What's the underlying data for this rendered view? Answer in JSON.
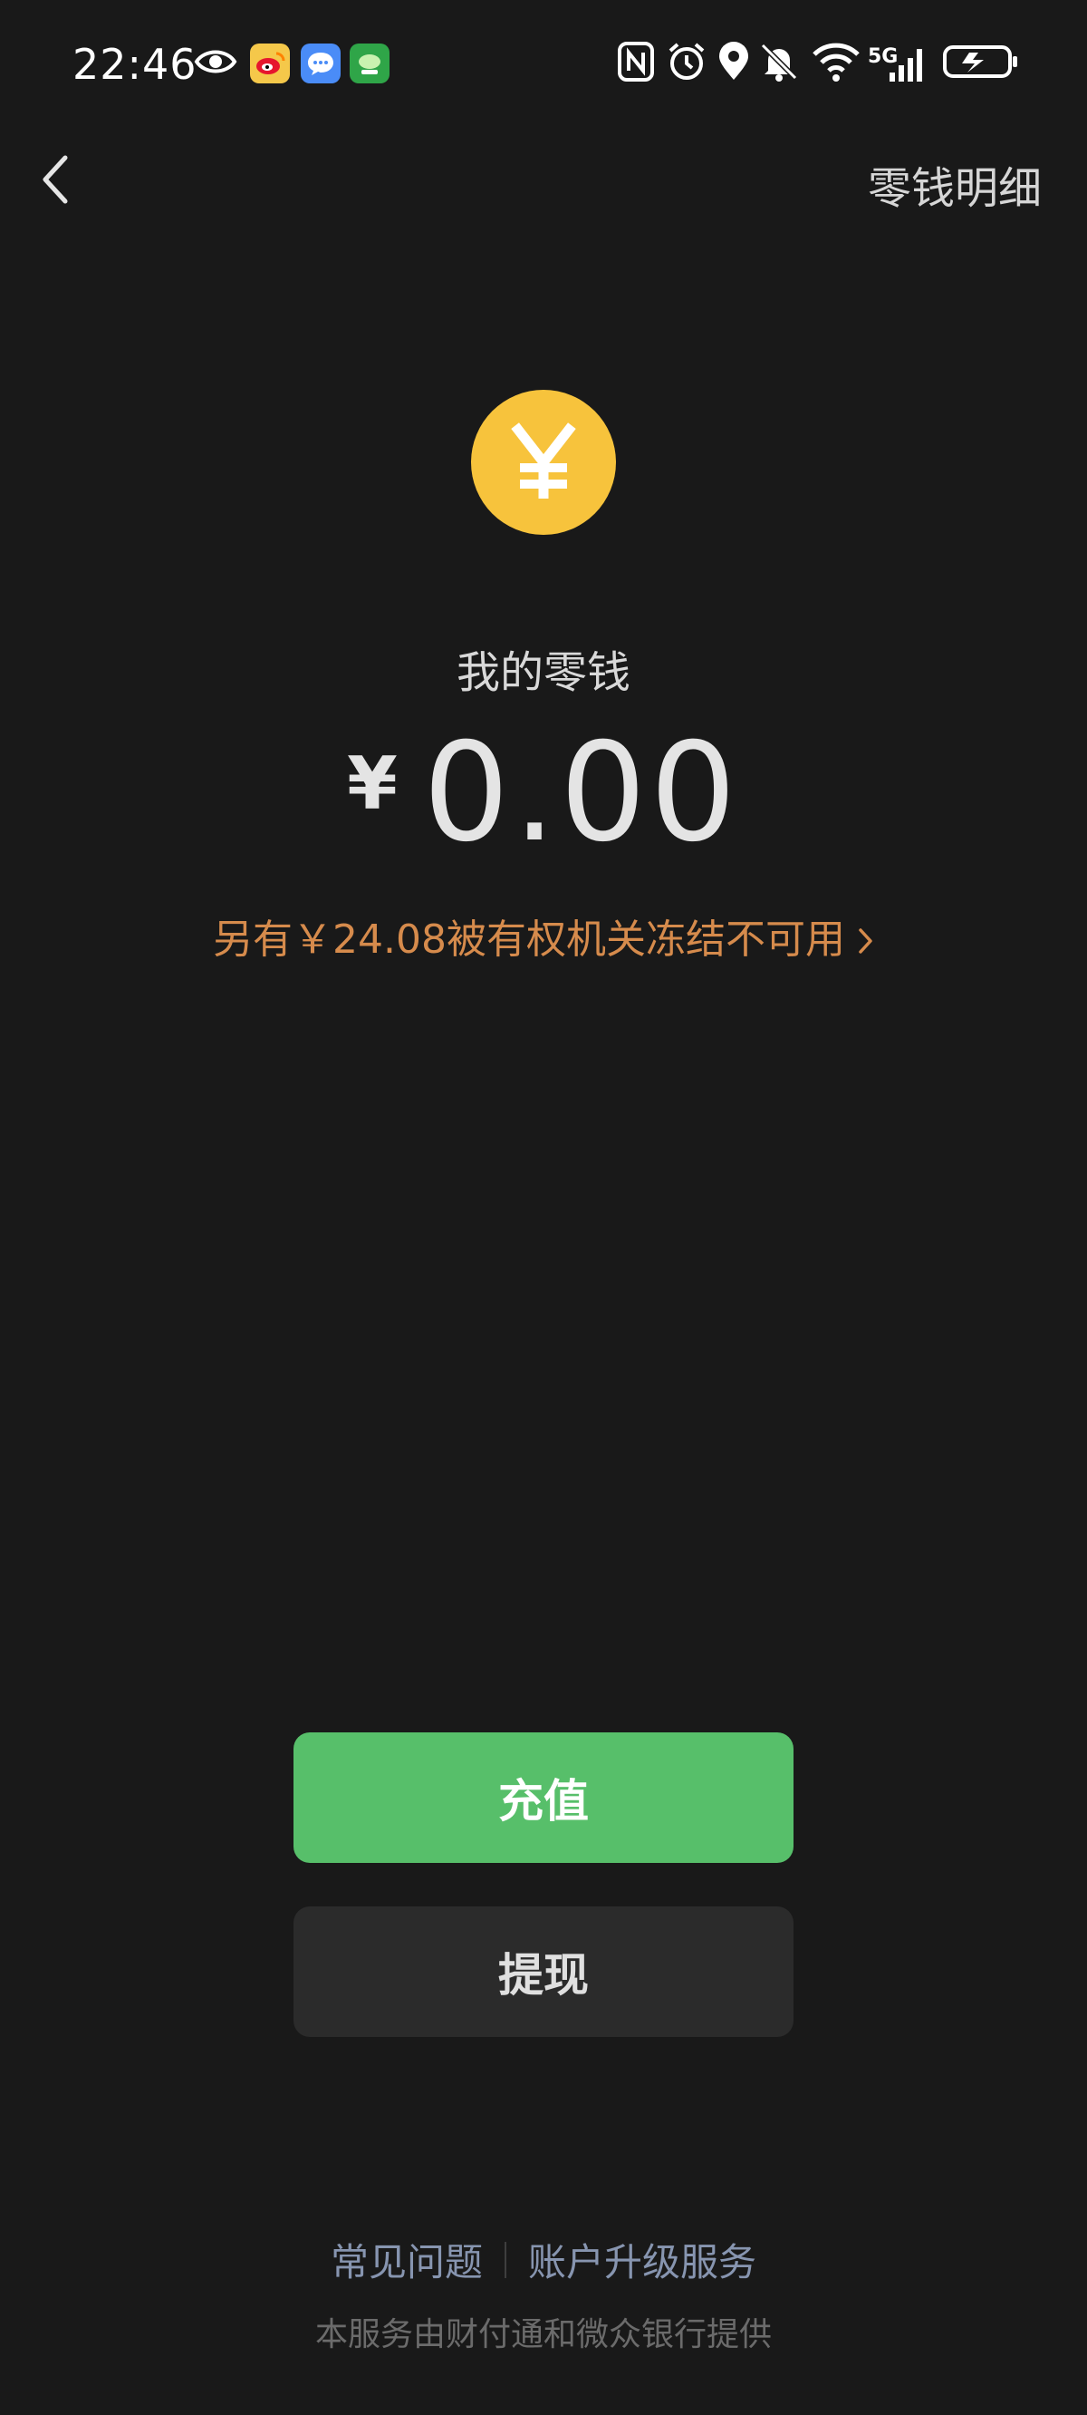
{
  "status_bar": {
    "time": "22:46",
    "network": "5G",
    "icons": [
      "eye-icon",
      "weibo-icon",
      "message-icon",
      "app-icon",
      "nfc-icon",
      "alarm-icon",
      "location-icon",
      "mute-icon",
      "wifi-icon",
      "signal-icon",
      "battery-charging-icon"
    ]
  },
  "nav": {
    "back_icon": "chevron-left-icon",
    "ledger_label": "零钱明细"
  },
  "balance": {
    "coin_symbol": "¥",
    "label": "我的零钱",
    "currency": "¥",
    "amount": "0.00",
    "frozen_notice": "另有￥24.08被有权机关冻结不可用"
  },
  "actions": {
    "recharge_label": "充值",
    "withdraw_label": "提现"
  },
  "footer": {
    "faq_label": "常见问题",
    "upgrade_label": "账户升级服务",
    "service_note": "本服务由财付通和微众银行提供"
  },
  "colors": {
    "background": "#191919",
    "coin": "#f7c33c",
    "recharge_button": "#57bf6a",
    "withdraw_button": "#2b2b2b",
    "frozen_text": "#d68b4c",
    "footer_link": "#8795b0"
  }
}
